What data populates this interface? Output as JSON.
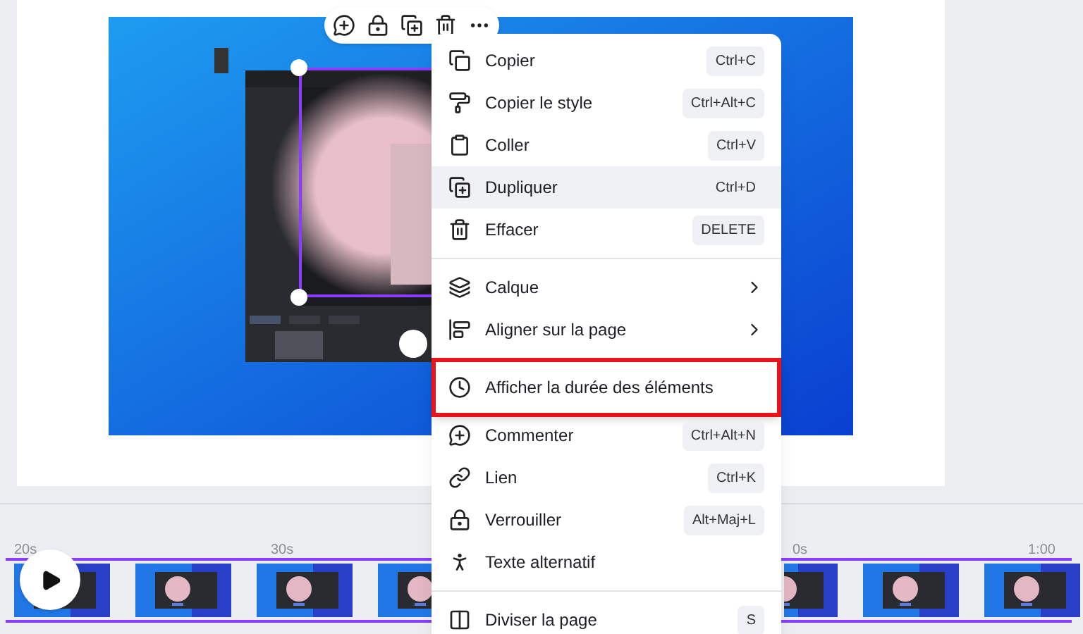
{
  "menu": {
    "items": [
      {
        "kind": "item",
        "label": "Copier",
        "shortcut": "Ctrl+C",
        "hovered": false,
        "outlined": false
      },
      {
        "kind": "item",
        "label": "Copier le style",
        "shortcut": "Ctrl+Alt+C",
        "hovered": false,
        "outlined": false
      },
      {
        "kind": "item",
        "label": "Coller",
        "shortcut": "Ctrl+V",
        "hovered": false,
        "outlined": false
      },
      {
        "kind": "item",
        "label": "Dupliquer",
        "shortcut": "Ctrl+D",
        "hovered": true,
        "outlined": false
      },
      {
        "kind": "item",
        "label": "Effacer",
        "shortcut": "DELETE",
        "hovered": false,
        "outlined": false
      },
      {
        "kind": "divider"
      },
      {
        "kind": "submenu",
        "label": "Calque",
        "hovered": false,
        "outlined": false
      },
      {
        "kind": "submenu",
        "label": "Aligner sur la page",
        "hovered": false,
        "outlined": false
      },
      {
        "kind": "divider"
      },
      {
        "kind": "item",
        "label": "Afficher la durée des éléments",
        "hovered": false,
        "outlined": true
      },
      {
        "kind": "item",
        "label": "Commenter",
        "shortcut": "Ctrl+Alt+N",
        "hovered": false,
        "outlined": false
      },
      {
        "kind": "item",
        "label": "Lien",
        "shortcut": "Ctrl+K",
        "hovered": false,
        "outlined": false
      },
      {
        "kind": "item",
        "label": "Verrouiller",
        "shortcut": "Alt+Maj+L",
        "hovered": false,
        "outlined": false
      },
      {
        "kind": "item",
        "label": "Texte alternatif",
        "hovered": false,
        "outlined": false
      },
      {
        "kind": "divider"
      },
      {
        "kind": "item",
        "label": "Diviser la page",
        "shortcut": "S",
        "hovered": false,
        "outlined": false
      }
    ]
  },
  "timeline": {
    "ruler_labels": [
      "20s",
      "30s",
      "0s",
      "1:00"
    ]
  }
}
